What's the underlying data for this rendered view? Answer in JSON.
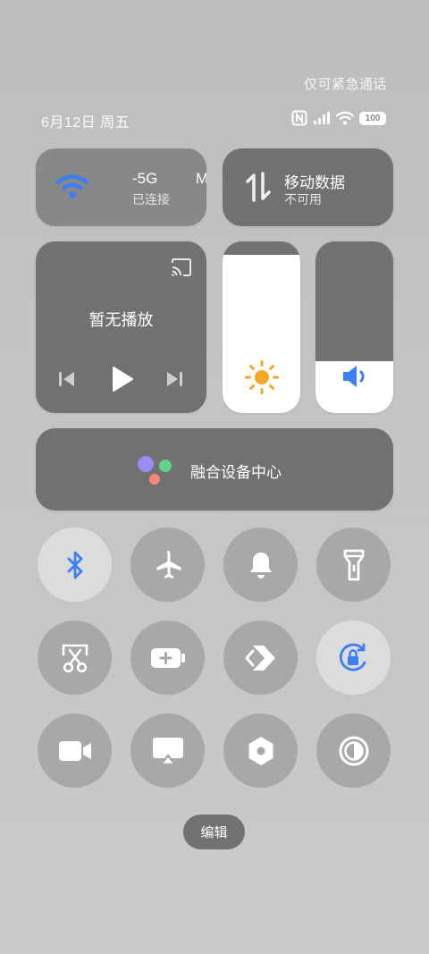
{
  "status_bar": {
    "emergency_text": "仅可紧急通话",
    "date": "6月12日 周五",
    "battery": "100",
    "icons": [
      "nfc-icon",
      "signal-icon",
      "wifi-icon",
      "battery-icon"
    ]
  },
  "wifi_tile": {
    "ssid_text": "-5G",
    "ssid_tail": "MIC",
    "status": "已连接",
    "icon": "wifi-icon",
    "accent": "#3d7ef5"
  },
  "data_tile": {
    "title": "移动数据",
    "status": "不可用",
    "icon": "data-arrows-icon"
  },
  "media_tile": {
    "status": "暂无播放",
    "icons": [
      "cast-icon",
      "previous-icon",
      "play-icon",
      "next-icon"
    ]
  },
  "brightness": {
    "level": 0.92,
    "icon": "sun-icon",
    "accent": "#f5a623"
  },
  "volume": {
    "level": 0.3,
    "icon": "speaker-icon",
    "accent": "#3d7ef5"
  },
  "hub_tile": {
    "label": "融合设备中心",
    "icon": "device-hub-icon"
  },
  "toggles": [
    {
      "name": "bluetooth",
      "icon": "bluetooth-icon",
      "active": true
    },
    {
      "name": "airplane-mode",
      "icon": "airplane-icon",
      "active": false
    },
    {
      "name": "ring-mode",
      "icon": "bell-icon",
      "active": false
    },
    {
      "name": "flashlight",
      "icon": "flashlight-icon",
      "active": false
    },
    {
      "name": "screenshot",
      "icon": "scissors-icon",
      "active": false
    },
    {
      "name": "power-saving",
      "icon": "battery-plus-icon",
      "active": false
    },
    {
      "name": "share",
      "icon": "share-icon",
      "active": false
    },
    {
      "name": "rotation-lock",
      "icon": "rotation-lock-icon",
      "active": true
    },
    {
      "name": "screen-record",
      "icon": "video-camera-icon",
      "active": false
    },
    {
      "name": "screen-cast",
      "icon": "screen-cast-icon",
      "active": false
    },
    {
      "name": "nfc-setting",
      "icon": "hexagon-icon",
      "active": false
    },
    {
      "name": "dark-mode",
      "icon": "contrast-icon",
      "active": false
    }
  ],
  "edit_label": "编辑"
}
